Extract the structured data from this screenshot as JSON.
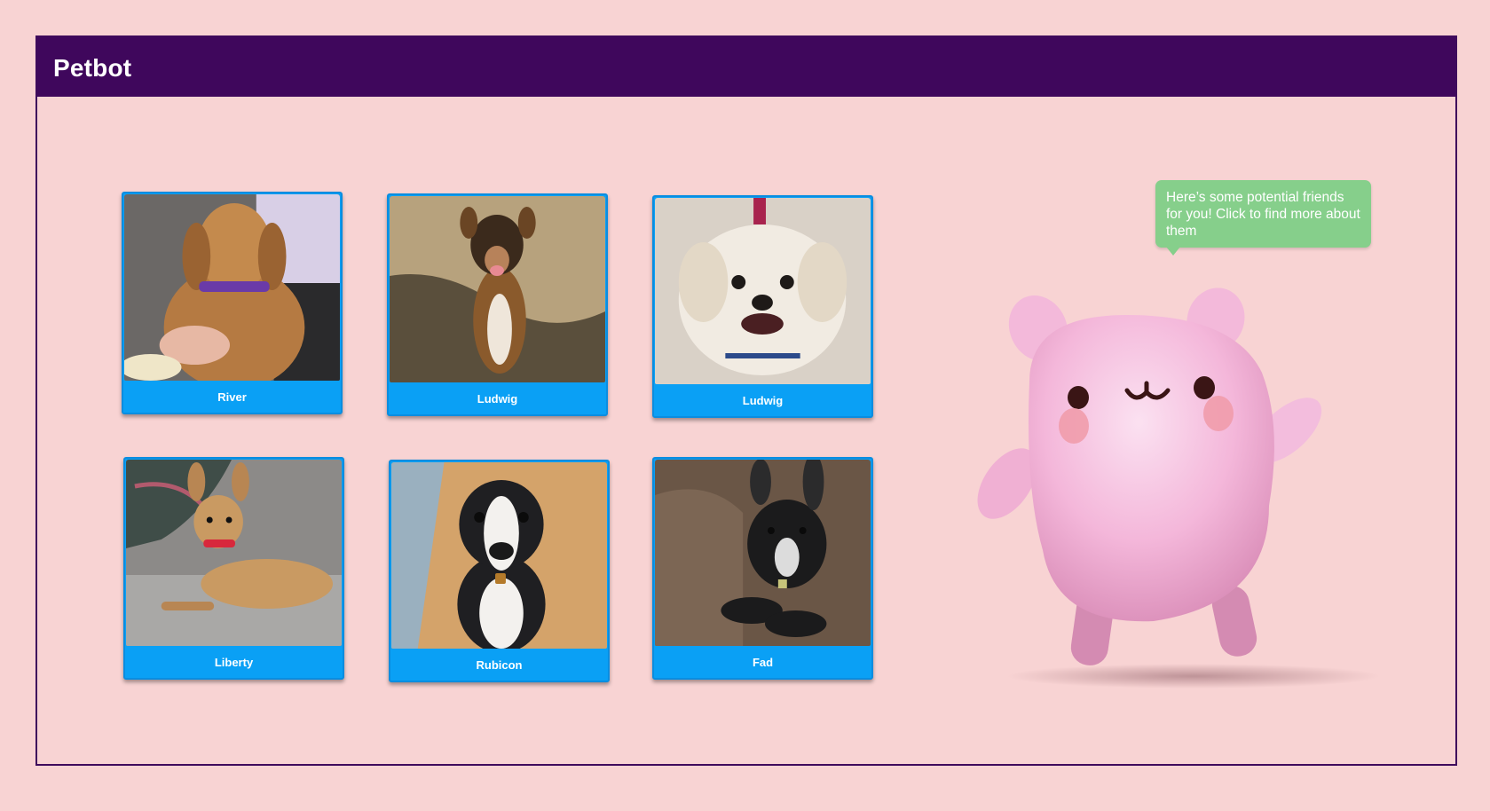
{
  "app": {
    "title": "Petbot"
  },
  "pets": [
    {
      "name": "River"
    },
    {
      "name": "Ludwig"
    },
    {
      "name": "Ludwig"
    },
    {
      "name": "Liberty"
    },
    {
      "name": "Rubicon"
    },
    {
      "name": "Fad"
    }
  ],
  "mascot": {
    "speech": "Here’s some potential friends for you! Click to find more about them"
  },
  "colors": {
    "background": "#f8d3d3",
    "header": "#3f075c",
    "card": "#0aa0f5",
    "bubble": "#86cf8b",
    "mascot": "#f6b8d9"
  }
}
